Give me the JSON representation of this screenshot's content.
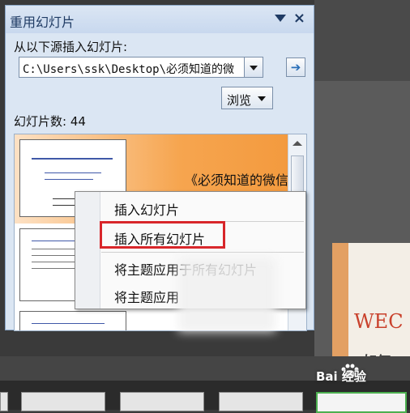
{
  "pane": {
    "title": "重用幻灯片",
    "source_label": "从以下源插入幻灯片:",
    "source_path": "C:\\Users\\ssk\\Desktop\\必须知道的微",
    "go_symbol": "➔",
    "browse_label": "浏览",
    "count_label": "幻灯片数: 44",
    "row1_title": "《必须知道的微信"
  },
  "context_menu": {
    "items": [
      "插入幻灯片",
      "插入所有幻灯片",
      "将主题应用于所有幻灯片",
      "将主题应用"
    ],
    "highlighted_index": 1
  },
  "background": {
    "slide_title": "WEC",
    "slide_subtitle": "如何",
    "watermark": "Bai  经验"
  },
  "colors": {
    "highlight": "#d8262a",
    "pane_bg": "#dbe6f3",
    "row_orange": "#f39a3e"
  }
}
